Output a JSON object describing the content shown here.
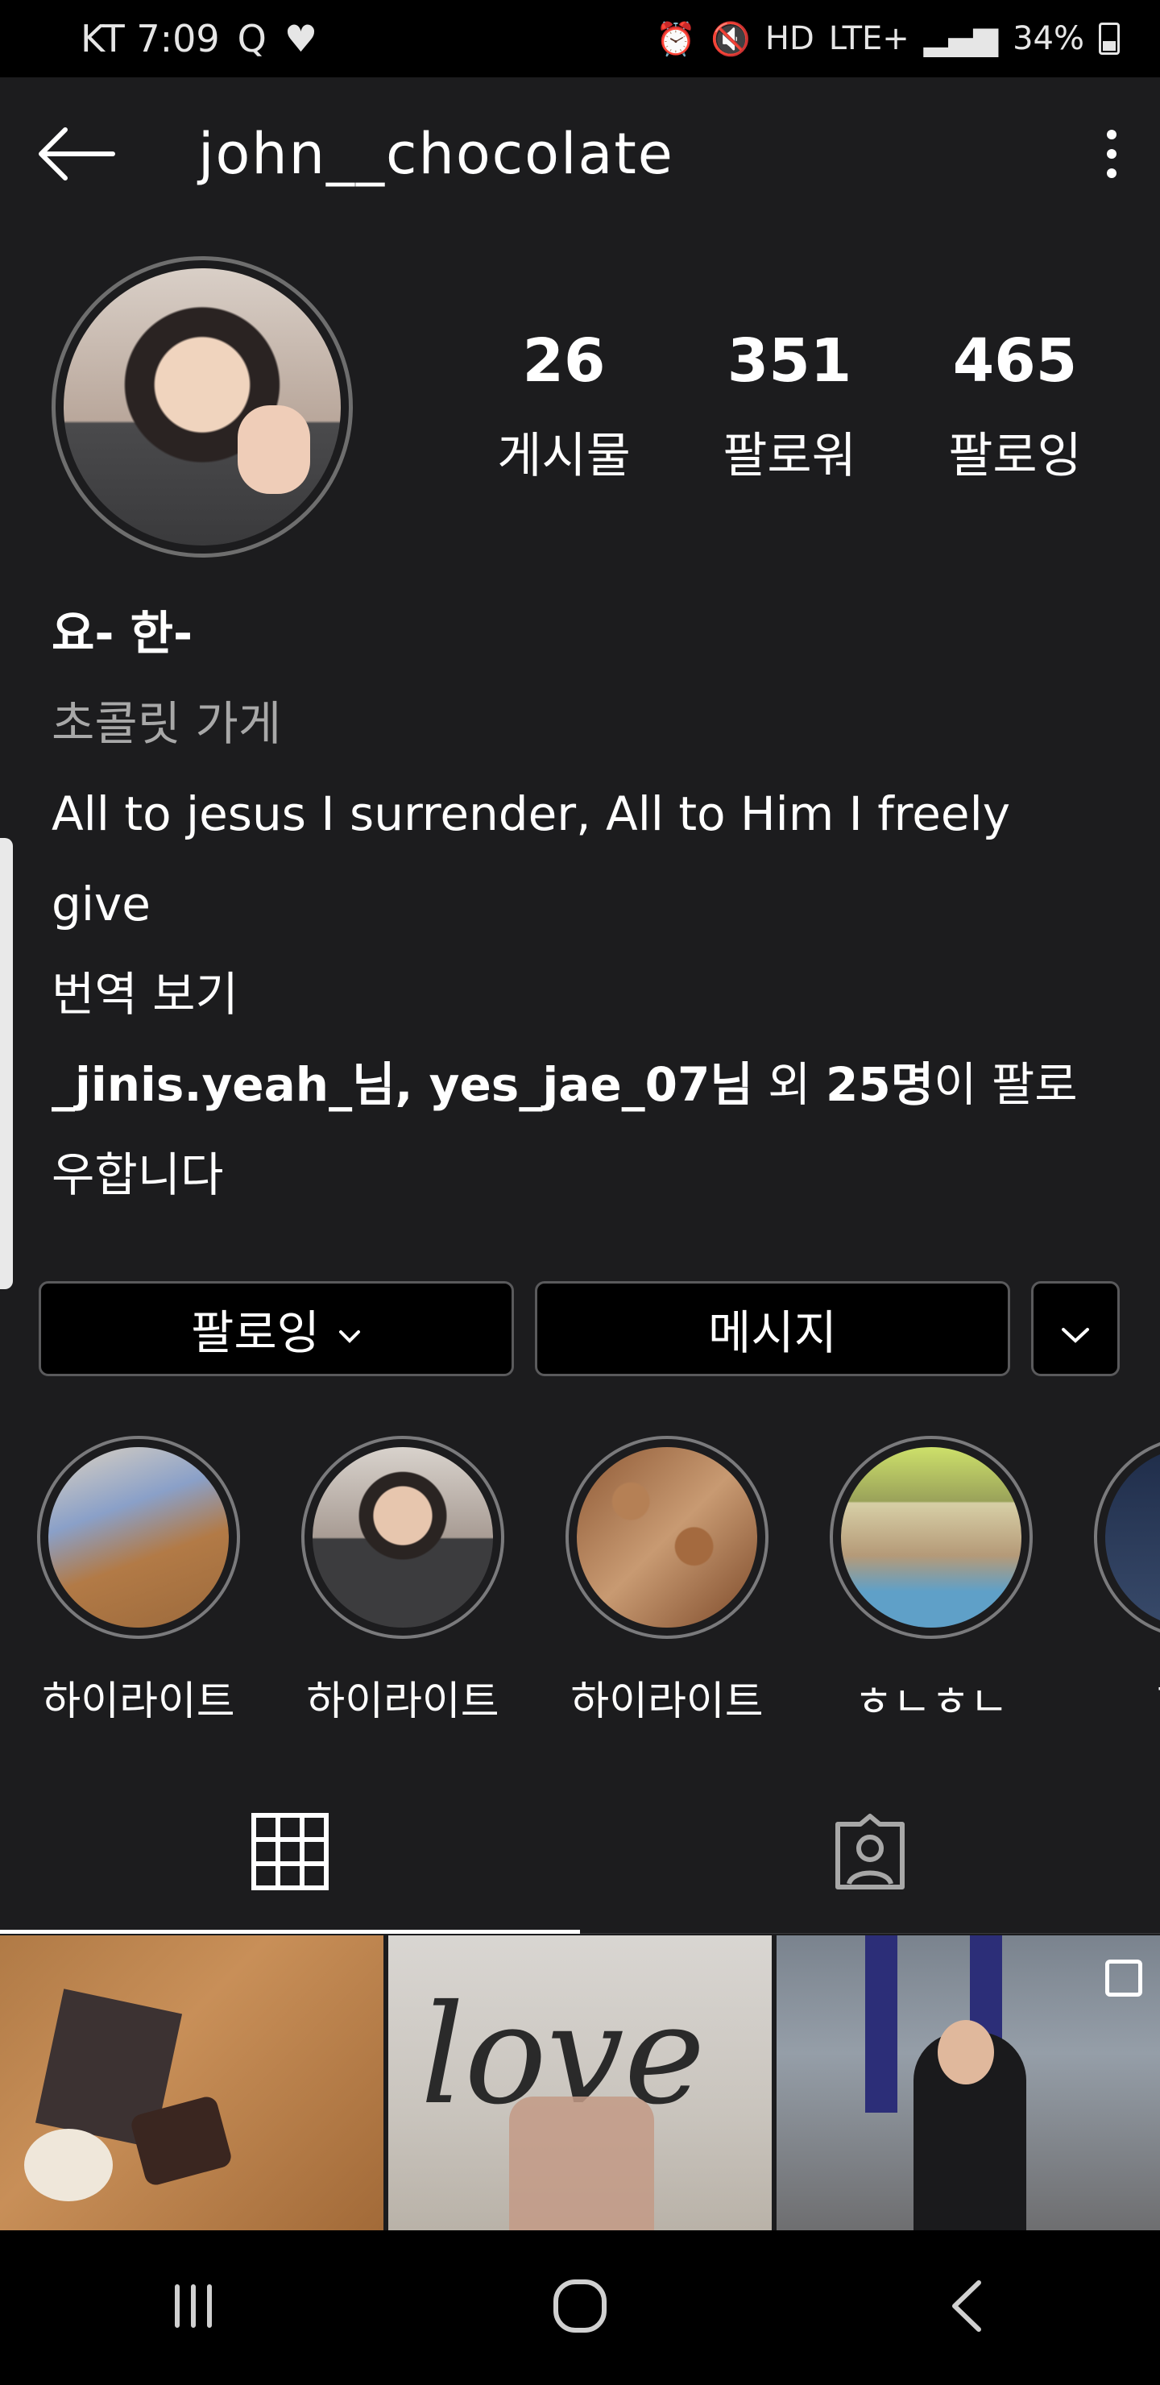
{
  "status_bar": {
    "carrier_time": "KT 7:09",
    "network": "LTE+",
    "hd": "HD",
    "battery": "34%",
    "icons": [
      "q-icon",
      "heart-icon",
      "alarm-icon",
      "mute-icon",
      "signal-icon",
      "battery-icon"
    ]
  },
  "header": {
    "username": "john__chocolate"
  },
  "stats": [
    {
      "value": "26",
      "label": "게시물"
    },
    {
      "value": "351",
      "label": "팔로워"
    },
    {
      "value": "465",
      "label": "팔로잉"
    }
  ],
  "bio": {
    "name": "요- 한-",
    "category": "초콜릿 가게",
    "text": "All to jesus I surrender, All to Him I freely give",
    "translate": "번역 보기",
    "followed_by_names": "_jinis.yeah_님, yes_jae_07님",
    "followed_by_mid": " 외 ",
    "followed_by_count": "25명",
    "followed_by_suffix": "이 팔로우합니다"
  },
  "actions": {
    "follow_label": "팔로잉",
    "message_label": "메시지"
  },
  "highlights": [
    {
      "label": "하이라이트"
    },
    {
      "label": "하이라이트"
    },
    {
      "label": "하이라이트"
    },
    {
      "label": "ㅎㄴㅎㄴ"
    },
    {
      "label": "하이"
    }
  ],
  "colors": {
    "background": "#1c1c1e",
    "status_bar": "#000000",
    "button_border": "#5a5a5c",
    "secondary_text": "#a8a8a8"
  }
}
